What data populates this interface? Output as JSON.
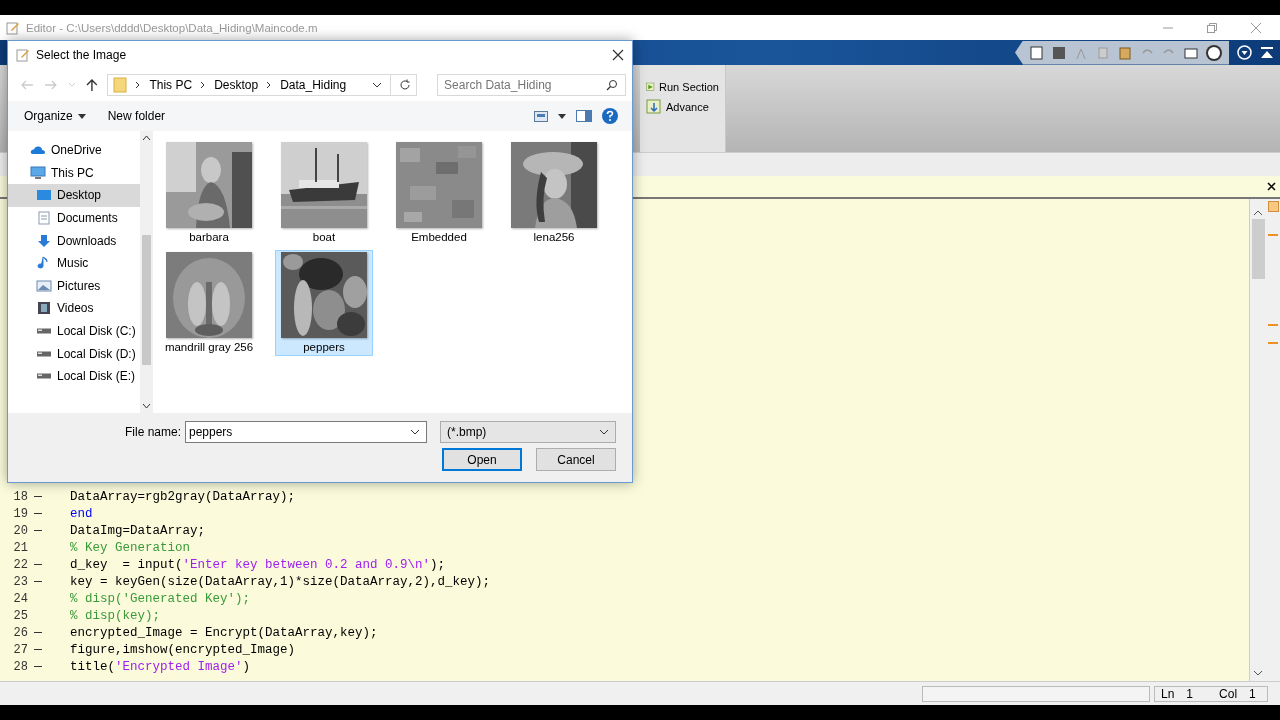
{
  "editor": {
    "title": "Editor - C:\\Users\\dddd\\Desktop\\Data_Hiding\\Maincode.m"
  },
  "toolstrip": {
    "buttons": [
      {
        "label": "Run Section"
      },
      {
        "label": "Advance"
      }
    ]
  },
  "code": {
    "lines": [
      {
        "number": "18",
        "executable": true,
        "segments": [
          {
            "kind": "plain",
            "text": "DataArray=rgb2gray(DataArray);"
          }
        ]
      },
      {
        "number": "19",
        "executable": true,
        "segments": [
          {
            "kind": "keyword",
            "text": "end"
          }
        ]
      },
      {
        "number": "20",
        "executable": true,
        "segments": [
          {
            "kind": "plain",
            "text": "DataImg=DataArray;"
          }
        ]
      },
      {
        "number": "21",
        "executable": false,
        "segments": [
          {
            "kind": "comment",
            "text": "% Key Generation"
          }
        ]
      },
      {
        "number": "22",
        "executable": true,
        "segments": [
          {
            "kind": "plain",
            "text": "d_key  = input("
          },
          {
            "kind": "string",
            "text": "'Enter key between 0.2 and 0.9\\n'"
          },
          {
            "kind": "plain",
            "text": ");"
          }
        ]
      },
      {
        "number": "23",
        "executable": true,
        "segments": [
          {
            "kind": "plain",
            "text": "key = keyGen(size(DataArray,1)*size(DataArray,2),d_key);"
          }
        ]
      },
      {
        "number": "24",
        "executable": false,
        "segments": [
          {
            "kind": "comment",
            "text": "% disp('Generated Key');"
          }
        ]
      },
      {
        "number": "25",
        "executable": false,
        "segments": [
          {
            "kind": "comment",
            "text": "% disp(key);"
          }
        ]
      },
      {
        "number": "26",
        "executable": true,
        "segments": [
          {
            "kind": "plain",
            "text": "encrypted_Image = Encrypt(DataArray,key);"
          }
        ]
      },
      {
        "number": "27",
        "executable": true,
        "segments": [
          {
            "kind": "plain",
            "text": "figure,imshow(encrypted_Image)"
          }
        ]
      },
      {
        "number": "28",
        "executable": true,
        "segments": [
          {
            "kind": "plain",
            "text": "title("
          },
          {
            "kind": "string",
            "text": "'Encrypted Image'"
          },
          {
            "kind": "plain",
            "text": ")"
          }
        ]
      }
    ]
  },
  "status_bar": {
    "ln_label": "Ln",
    "ln": "1",
    "col_label": "Col",
    "col": "1"
  },
  "dialog": {
    "title": "Select the Image",
    "breadcrumbs": [
      "This PC",
      "Desktop",
      "Data_Hiding"
    ],
    "search": {
      "placeholder": "Search Data_Hiding"
    },
    "toolbar": {
      "organize": "Organize",
      "new_folder": "New folder"
    },
    "sidebar": {
      "items": [
        {
          "label": "OneDrive",
          "selected": false
        },
        {
          "label": "This PC",
          "selected": false,
          "children": [
            {
              "label": "Desktop",
              "selected": true
            },
            {
              "label": "Documents",
              "selected": false
            },
            {
              "label": "Downloads",
              "selected": false
            },
            {
              "label": "Music",
              "selected": false
            },
            {
              "label": "Pictures",
              "selected": false
            },
            {
              "label": "Videos",
              "selected": false
            },
            {
              "label": "Local Disk (C:)",
              "selected": false
            },
            {
              "label": "Local Disk (D:)",
              "selected": false
            },
            {
              "label": "Local Disk (E:)",
              "selected": false
            }
          ]
        }
      ]
    },
    "files": [
      {
        "name": "barbara",
        "selected": false
      },
      {
        "name": "boat",
        "selected": false
      },
      {
        "name": "Embedded",
        "selected": false
      },
      {
        "name": "lena256",
        "selected": false
      },
      {
        "name": "mandrill gray 256",
        "selected": false
      },
      {
        "name": "peppers",
        "selected": true
      }
    ],
    "file_name": {
      "label": "File name:",
      "value": "peppers"
    },
    "filter": "(*.bmp)",
    "buttons": [
      {
        "label": "Open",
        "default": true
      },
      {
        "label": "Cancel",
        "default": false
      }
    ]
  }
}
